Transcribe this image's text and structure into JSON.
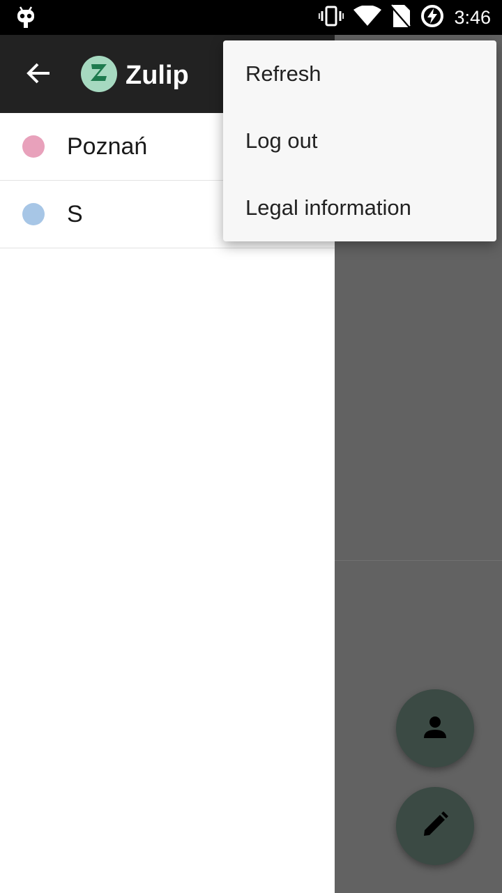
{
  "status_bar": {
    "time": "3:46",
    "icons": [
      "cyanogen-bug-icon",
      "vibrate-icon",
      "wifi-icon",
      "no-sim-icon",
      "battery-charging-icon"
    ]
  },
  "app_bar": {
    "title": "Zulip",
    "back_icon": "arrow-back-icon",
    "logo_letter": "Z"
  },
  "streams": [
    {
      "name": "Poznań",
      "color": "#e8a1bb"
    },
    {
      "name": "S",
      "color": "#a7c6e6"
    }
  ],
  "menu": {
    "items": [
      "Refresh",
      "Log out",
      "Legal information"
    ]
  },
  "fabs": [
    {
      "icon": "person-icon"
    },
    {
      "icon": "pencil-icon"
    }
  ],
  "colors": {
    "app_bar": "#222222",
    "fab": "#3b4a44",
    "scrim": "#626262",
    "logo_bg": "#a6d9c0",
    "logo_fg": "#1e7a4e"
  }
}
